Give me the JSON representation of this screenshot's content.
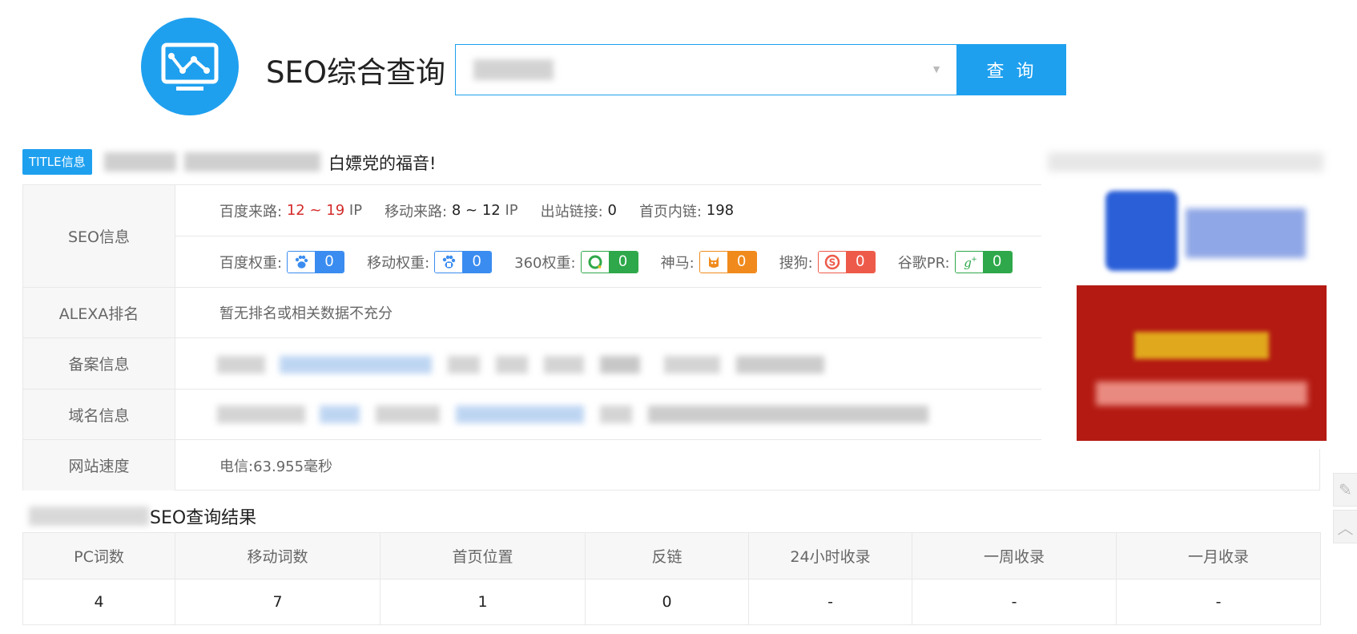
{
  "header": {
    "app_title": "SEO综合查询",
    "search_button": "查 询"
  },
  "title_info": {
    "badge": "TITLE信息",
    "text": "白嫖党的福音!"
  },
  "seo_info": {
    "label": "SEO信息",
    "baidu_traffic_label": "百度来路:",
    "baidu_traffic_value": "12 ~ 19",
    "baidu_traffic_unit": "IP",
    "mobile_traffic_label": "移动来路:",
    "mobile_traffic_value": "8 ~ 12",
    "mobile_traffic_unit": "IP",
    "outbound_label": "出站链接:",
    "outbound_value": "0",
    "internal_label": "首页内链:",
    "internal_value": "198",
    "weights": [
      {
        "label": "百度权重:",
        "icon": "baidu-paw-icon",
        "value": "0"
      },
      {
        "label": "移动权重:",
        "icon": "mobile-paw-icon",
        "value": "0"
      },
      {
        "label": "360权重:",
        "icon": "360-icon",
        "value": "0"
      },
      {
        "label": "神马:",
        "icon": "shenma-icon",
        "value": "0"
      },
      {
        "label": "搜狗:",
        "icon": "sogou-icon",
        "value": "0"
      },
      {
        "label": "谷歌PR:",
        "icon": "google-plus-icon",
        "value": "0"
      }
    ]
  },
  "alexa": {
    "label": "ALEXA排名",
    "value": "暂无排名或相关数据不充分"
  },
  "icp": {
    "label": "备案信息"
  },
  "domain": {
    "label": "域名信息"
  },
  "speed": {
    "label": "网站速度",
    "value": "电信:63.955毫秒"
  },
  "results": {
    "title": "SEO查询结果",
    "headers": [
      "PC词数",
      "移动词数",
      "首页位置",
      "反链",
      "24小时收录",
      "一周收录",
      "一月收录"
    ],
    "values": [
      "4",
      "7",
      "1",
      "0",
      "-",
      "-",
      "-"
    ]
  },
  "colors": {
    "accent": "#1ea0ef",
    "red": "#d42b2b"
  }
}
